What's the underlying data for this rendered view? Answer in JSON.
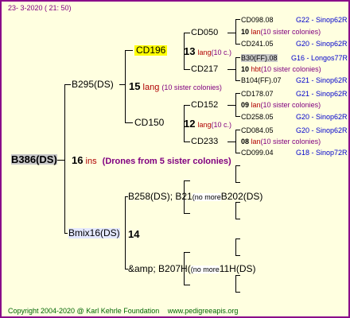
{
  "header": {
    "date": "23-  3-2020 ( 21: 50)"
  },
  "root": {
    "label": "B386(DS)",
    "generation": "16",
    "origin": "ins",
    "note": "(Drones from 5 sister colonies)"
  },
  "sire": {
    "label": "B295(DS)",
    "generation": "15",
    "origin": "lang",
    "note": "(10 sister colonies)"
  },
  "sire_sire": {
    "label": "CD196",
    "generation": "13",
    "origin": "lang",
    "note": "(10 c.)"
  },
  "sire_dam": {
    "label": "CD150",
    "generation": "12",
    "origin": "lang",
    "note": "(10 c.)"
  },
  "n_cd050": {
    "label": "CD050"
  },
  "n_cd217": {
    "label": "CD217"
  },
  "n_cd152": {
    "label": "CD152"
  },
  "n_cd233": {
    "label": "CD233"
  },
  "leaves": [
    {
      "id": "CD098.08",
      "gen": "",
      "origin": "",
      "note": "",
      "breeder": "G22 - Sinop62R"
    },
    {
      "id": "",
      "gen": "10",
      "origin": "lan",
      "note": "(10 sister colonies)",
      "breeder": ""
    },
    {
      "id": "CD241.05",
      "gen": "",
      "origin": "",
      "note": "",
      "breeder": "G20 - Sinop62R"
    },
    {
      "id": "B30(FF).08",
      "gen": "",
      "origin": "",
      "note": "",
      "breeder": "G16 - Longos77R"
    },
    {
      "id": "",
      "gen": "10",
      "origin": "hbt",
      "note": "(10 sister colonies)",
      "breeder": ""
    },
    {
      "id": "B104(FF).07",
      "gen": "",
      "origin": "",
      "note": "",
      "breeder": "G21 - Sinop62R"
    },
    {
      "id": "CD178.07",
      "gen": "",
      "origin": "",
      "note": "",
      "breeder": "G21 - Sinop62R"
    },
    {
      "id": "",
      "gen": "09",
      "origin": "lan",
      "note": "(10 sister colonies)",
      "breeder": ""
    },
    {
      "id": "CD258.05",
      "gen": "",
      "origin": "",
      "note": "",
      "breeder": "G20 - Sinop62R"
    },
    {
      "id": "CD084.05",
      "gen": "",
      "origin": "",
      "note": "",
      "breeder": "G20 - Sinop62R"
    },
    {
      "id": "",
      "gen": "08",
      "origin": "lan",
      "note": "(10 sister colonies)",
      "breeder": ""
    },
    {
      "id": "CD099.04",
      "gen": "",
      "origin": "",
      "note": "",
      "breeder": "G18 - Sinop72R"
    }
  ],
  "dam": {
    "label": "Bmix16(DS)",
    "generation": "14"
  },
  "dam_sire": {
    "label": "B258(DS); B21",
    "more": "(no more",
    "tail": "B202(DS)"
  },
  "dam_dam": {
    "label": "&amp; B207H(",
    "more": "(no more",
    "tail": "11H(DS)"
  },
  "footer": {
    "copyright": "Copyright 2004-2020 @ Karl Kehrle Foundation",
    "site": "www.pedigreeapis.org"
  },
  "colors": {
    "border": "#8a0a8a",
    "background": "#ffffe0",
    "highlight": "#ffff00",
    "origin": "#b00000",
    "note": "#800080",
    "breeder": "#0000cc",
    "footer": "#006600"
  }
}
